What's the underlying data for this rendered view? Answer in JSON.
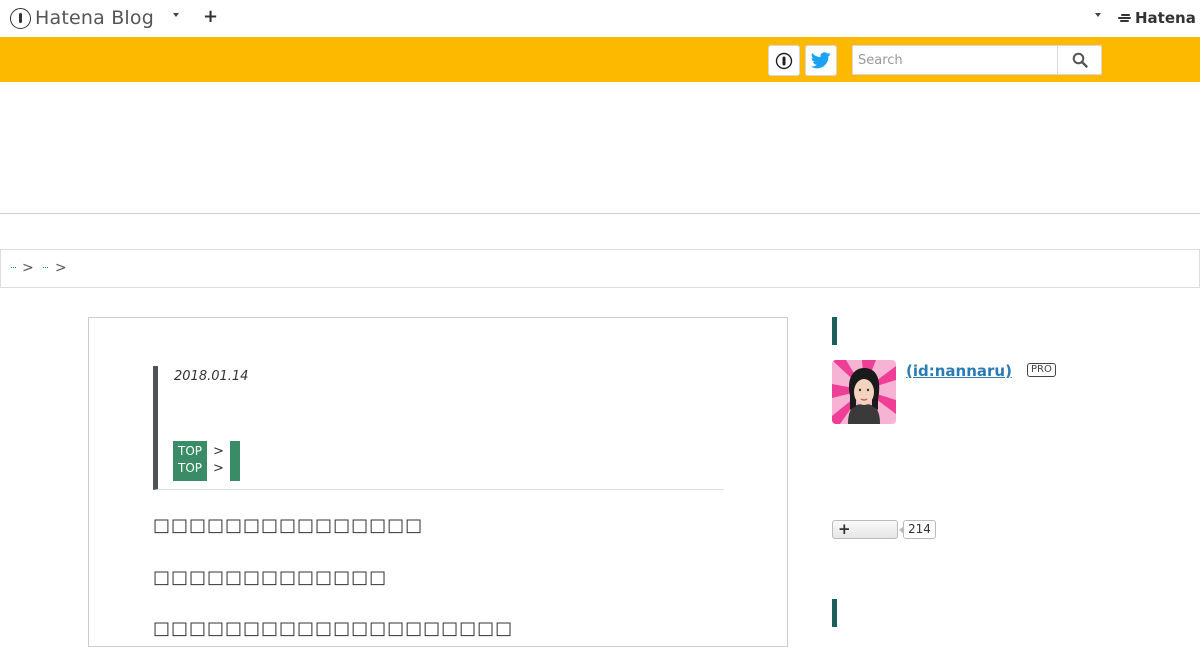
{
  "global_header": {
    "brand": "Hatena Blog",
    "add_icon": "plus-icon",
    "account_logo": "Hatena"
  },
  "toolbar": {
    "search": {
      "placeholder": "Search",
      "value": ""
    }
  },
  "breadcrumb": {
    "separator": ">"
  },
  "entry": {
    "date": "2018.01.14",
    "categories": [
      "TOP",
      "TOP"
    ],
    "category_separator": ">",
    "paragraphs": [
      "□□□□□□□□□□□□□□□",
      "□□□□□□□□□□□□□",
      "□□□□□□□□□□□□□□□□□□□□"
    ]
  },
  "sidebar": {
    "profile": {
      "id": " (id:nannaru)",
      "badge": "PRO"
    },
    "subscribe": {
      "count": "214"
    }
  },
  "colors": {
    "brand_yellow": "#fcb900",
    "category_green": "#3a8c66",
    "link_blue": "#2a7bb5",
    "accent_dark": "#1f5f5a"
  }
}
